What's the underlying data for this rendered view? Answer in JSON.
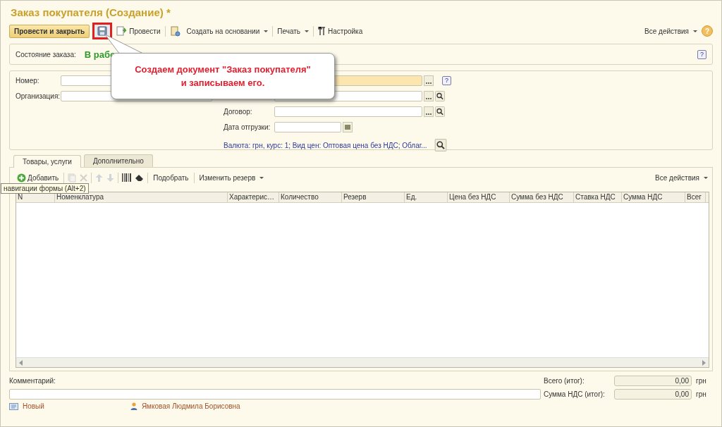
{
  "window": {
    "title": "Заказ покупателя (Создание) *"
  },
  "toolbar": {
    "items": [
      {
        "kind": "primary",
        "label": "Провести и закрыть"
      },
      {
        "kind": "icon",
        "highlighted": true
      },
      {
        "kind": "button",
        "label": "Провести"
      },
      {
        "kind": "separator"
      },
      {
        "kind": "icon",
        "highlighted": false
      },
      {
        "kind": "menu",
        "label": "Создать на основании"
      },
      {
        "kind": "separator"
      },
      {
        "kind": "menu",
        "label": "Печать"
      },
      {
        "kind": "separator"
      },
      {
        "kind": "button",
        "label": "Настройка"
      }
    ],
    "all_actions": "Все действия",
    "help": "?"
  },
  "state": {
    "label": "Состояние заказа:",
    "value": "В рабо",
    "help": "?"
  },
  "header": {
    "help": "?",
    "number": {
      "label": "Номер:"
    },
    "organization": {
      "label": "Организация:"
    },
    "contract": {
      "label": "Договор:"
    },
    "ship_date": {
      "label": "Дата отгрузки:"
    },
    "prices_link": "Валюта: грн, курс: 1; Вид цен: Оптовая цена без НДС; Облаг..."
  },
  "callout": {
    "text": "Создаем документ \"Заказ покупателя\"\nи записываем его."
  },
  "tabs": [
    {
      "label": "Товары, услуги",
      "selected": true
    },
    {
      "label": "Дополнительно",
      "selected": false
    }
  ],
  "table_toolbar": {
    "items": [
      {
        "kind": "icon-label",
        "label": "Добавить",
        "disabled": false
      },
      {
        "kind": "separator"
      },
      {
        "kind": "icon",
        "disabled": true
      },
      {
        "kind": "icon",
        "disabled": true
      },
      {
        "kind": "separator"
      },
      {
        "kind": "icon",
        "disabled": true
      },
      {
        "kind": "icon",
        "disabled": true
      },
      {
        "kind": "separator"
      },
      {
        "kind": "icon",
        "disabled": false
      },
      {
        "kind": "icon",
        "disabled": false
      },
      {
        "kind": "separator"
      },
      {
        "kind": "label",
        "label": "Подобрать",
        "disabled": false
      },
      {
        "kind": "separator"
      },
      {
        "kind": "menu",
        "label": "Изменить резерв",
        "disabled": false
      }
    ],
    "all_actions": "Все действия"
  },
  "tooltip": "навигации формы (Alt+2)",
  "table": {
    "columns": [
      "N",
      "Номенклатура",
      "Характерис…",
      "Количество",
      "Резерв",
      "Ед.",
      "Цена без НДС",
      "Сумма без НДС",
      "Ставка НДС",
      "Сумма НДС",
      "Всег"
    ]
  },
  "footer": {
    "comment_label": "Комментарий:",
    "totals": [
      {
        "label": "Всего (итог):",
        "value": "0,00",
        "currency": "грн"
      },
      {
        "label": "Сумма НДС (итог):",
        "value": "0,00",
        "currency": "грн"
      }
    ]
  },
  "status_bar": {
    "state": "Новый",
    "author": "Ямковая Людмила Борисовна"
  }
}
